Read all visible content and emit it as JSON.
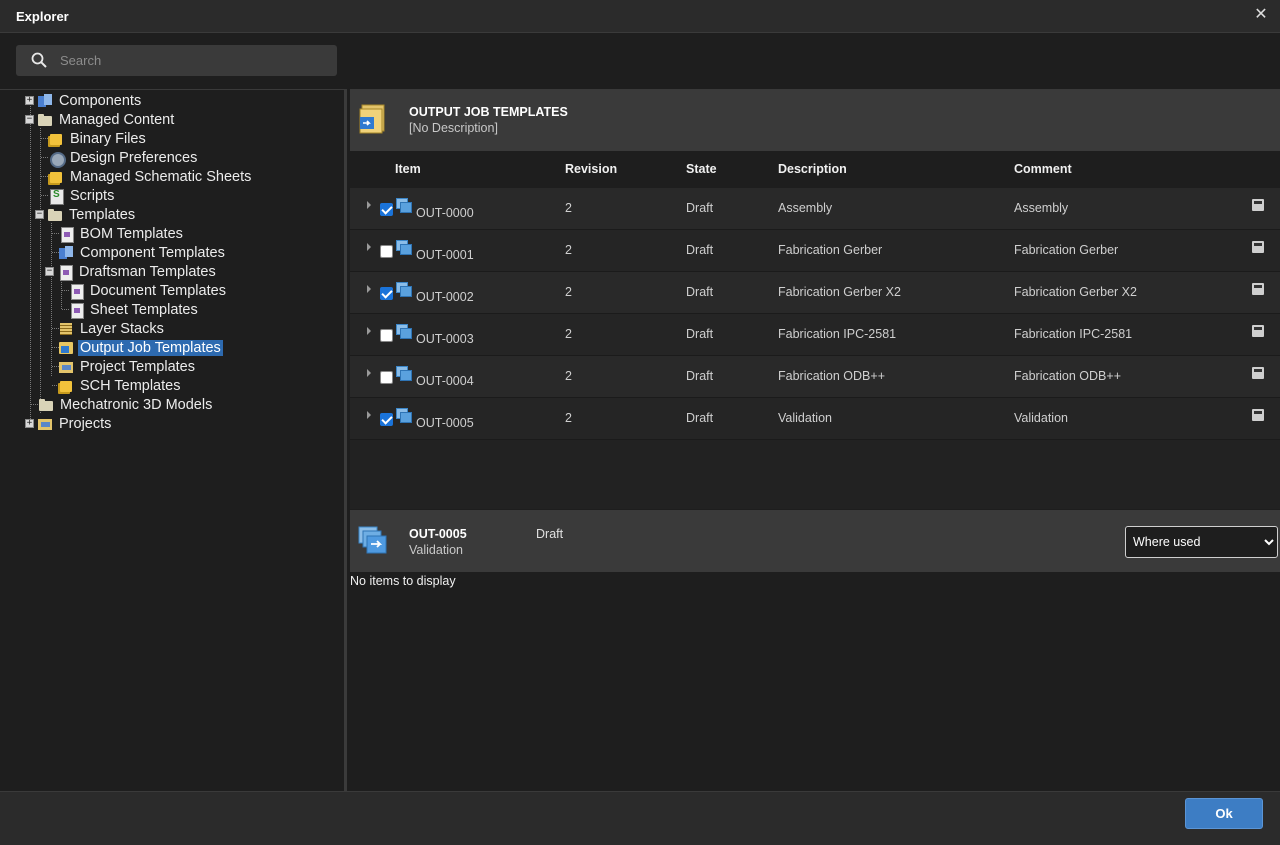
{
  "window": {
    "title": "Explorer",
    "close_glyph": "✕"
  },
  "search": {
    "placeholder": "Search",
    "icon": "search-icon"
  },
  "tree": {
    "items": [
      {
        "label": "Components",
        "icon": "components-icon"
      },
      {
        "label": "Managed Content",
        "icon": "folder-icon"
      },
      {
        "label": "Binary Files",
        "icon": "folder-icon"
      },
      {
        "label": "Design Preferences",
        "icon": "gear-icon"
      },
      {
        "label": "Managed Schematic Sheets",
        "icon": "sheets-icon"
      },
      {
        "label": "Scripts",
        "icon": "script-icon"
      },
      {
        "label": "Templates",
        "icon": "folder-icon"
      },
      {
        "label": "BOM Templates",
        "icon": "template-icon"
      },
      {
        "label": "Component Templates",
        "icon": "template-icon"
      },
      {
        "label": "Draftsman Templates",
        "icon": "template-icon"
      },
      {
        "label": "Document Templates",
        "icon": "template-icon"
      },
      {
        "label": "Sheet Templates",
        "icon": "template-icon"
      },
      {
        "label": "Layer Stacks",
        "icon": "layer-icon"
      },
      {
        "label": "Output Job Templates",
        "icon": "output-job-icon"
      },
      {
        "label": "Project Templates",
        "icon": "project-icon"
      },
      {
        "label": "SCH Templates",
        "icon": "sheets-icon"
      },
      {
        "label": "Mechatronic 3D Models",
        "icon": "folder-icon"
      },
      {
        "label": "Projects",
        "icon": "project-icon"
      }
    ],
    "selected": "Output Job Templates"
  },
  "panel": {
    "title": "OUTPUT JOB TEMPLATES",
    "subtitle": "[No Description]",
    "columns": [
      "Item",
      "Revision",
      "State",
      "Description",
      "Comment"
    ],
    "rows": [
      {
        "item": "OUT-0000",
        "revision": "2",
        "state": "Draft",
        "description": "Assembly",
        "comment": "Assembly",
        "checked": true
      },
      {
        "item": "OUT-0001",
        "revision": "2",
        "state": "Draft",
        "description": "Fabrication Gerber",
        "comment": "Fabrication Gerber",
        "checked": false
      },
      {
        "item": "OUT-0002",
        "revision": "2",
        "state": "Draft",
        "description": "Fabrication Gerber X2",
        "comment": "Fabrication Gerber X2",
        "checked": true
      },
      {
        "item": "OUT-0003",
        "revision": "2",
        "state": "Draft",
        "description": "Fabrication IPC-2581",
        "comment": "Fabrication IPC-2581",
        "checked": false
      },
      {
        "item": "OUT-0004",
        "revision": "2",
        "state": "Draft",
        "description": "Fabrication ODB++",
        "comment": "Fabrication ODB++",
        "checked": false
      },
      {
        "item": "OUT-0005",
        "revision": "2",
        "state": "Draft",
        "description": "Validation",
        "comment": "Validation",
        "checked": true
      }
    ]
  },
  "detail": {
    "item": "OUT-0005",
    "description": "Validation",
    "state": "Draft",
    "view_select": "Where used",
    "empty_text": "No items to display"
  },
  "footer": {
    "ok_label": "Ok"
  },
  "colors": {
    "accent": "#3d7dc4",
    "selection": "#2d6ab0",
    "checkbox": "#1a73d9"
  }
}
